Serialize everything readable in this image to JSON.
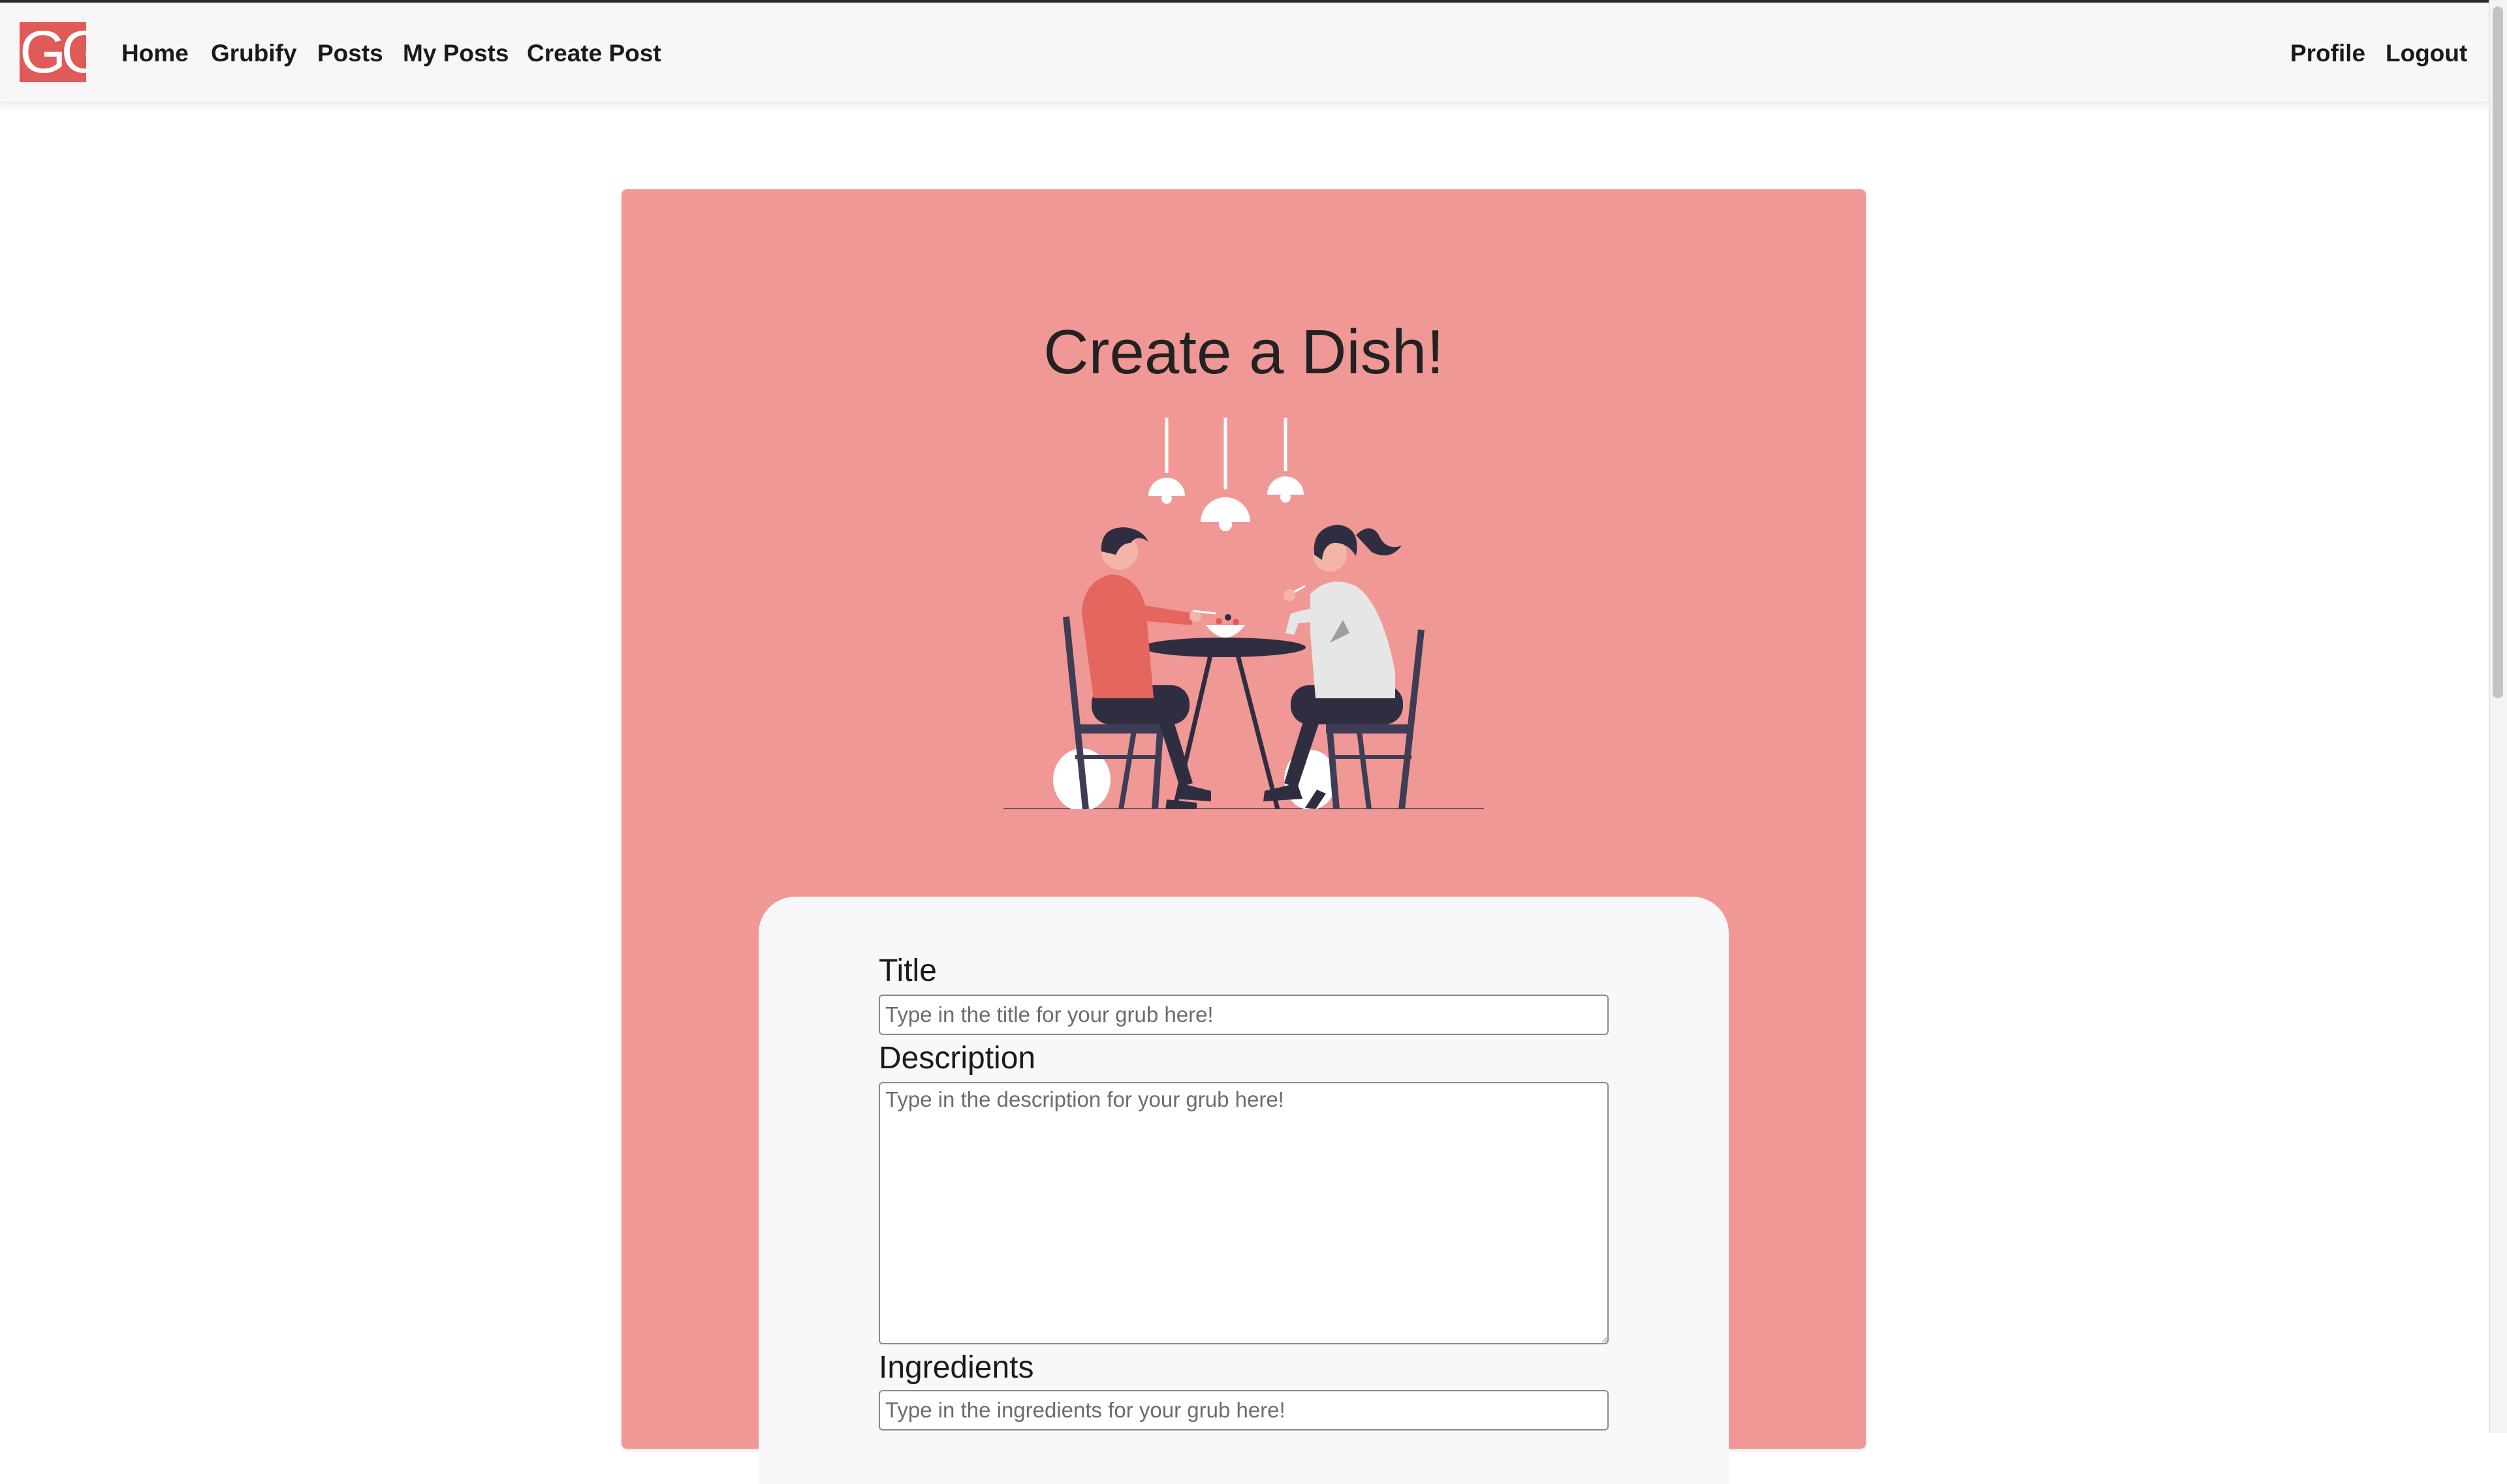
{
  "navbar": {
    "logo_text": "GG",
    "links": {
      "home": "Home",
      "grubify": "Grubify",
      "posts": "Posts",
      "my_posts": "My Posts",
      "create_post": "Create Post",
      "profile": "Profile",
      "logout": "Logout"
    },
    "logo_color": "#e05a57"
  },
  "card": {
    "heading": "Create a Dish!",
    "background_color": "#f09896",
    "illustration_icon": "dining-couple-illustration"
  },
  "form": {
    "title": {
      "label": "Title",
      "placeholder": "Type in the title for your grub here!"
    },
    "description": {
      "label": "Description",
      "placeholder": "Type in the description for your grub here!"
    },
    "ingredients": {
      "label": "Ingredients",
      "placeholder": "Type in the ingredients for your grub here!"
    }
  }
}
